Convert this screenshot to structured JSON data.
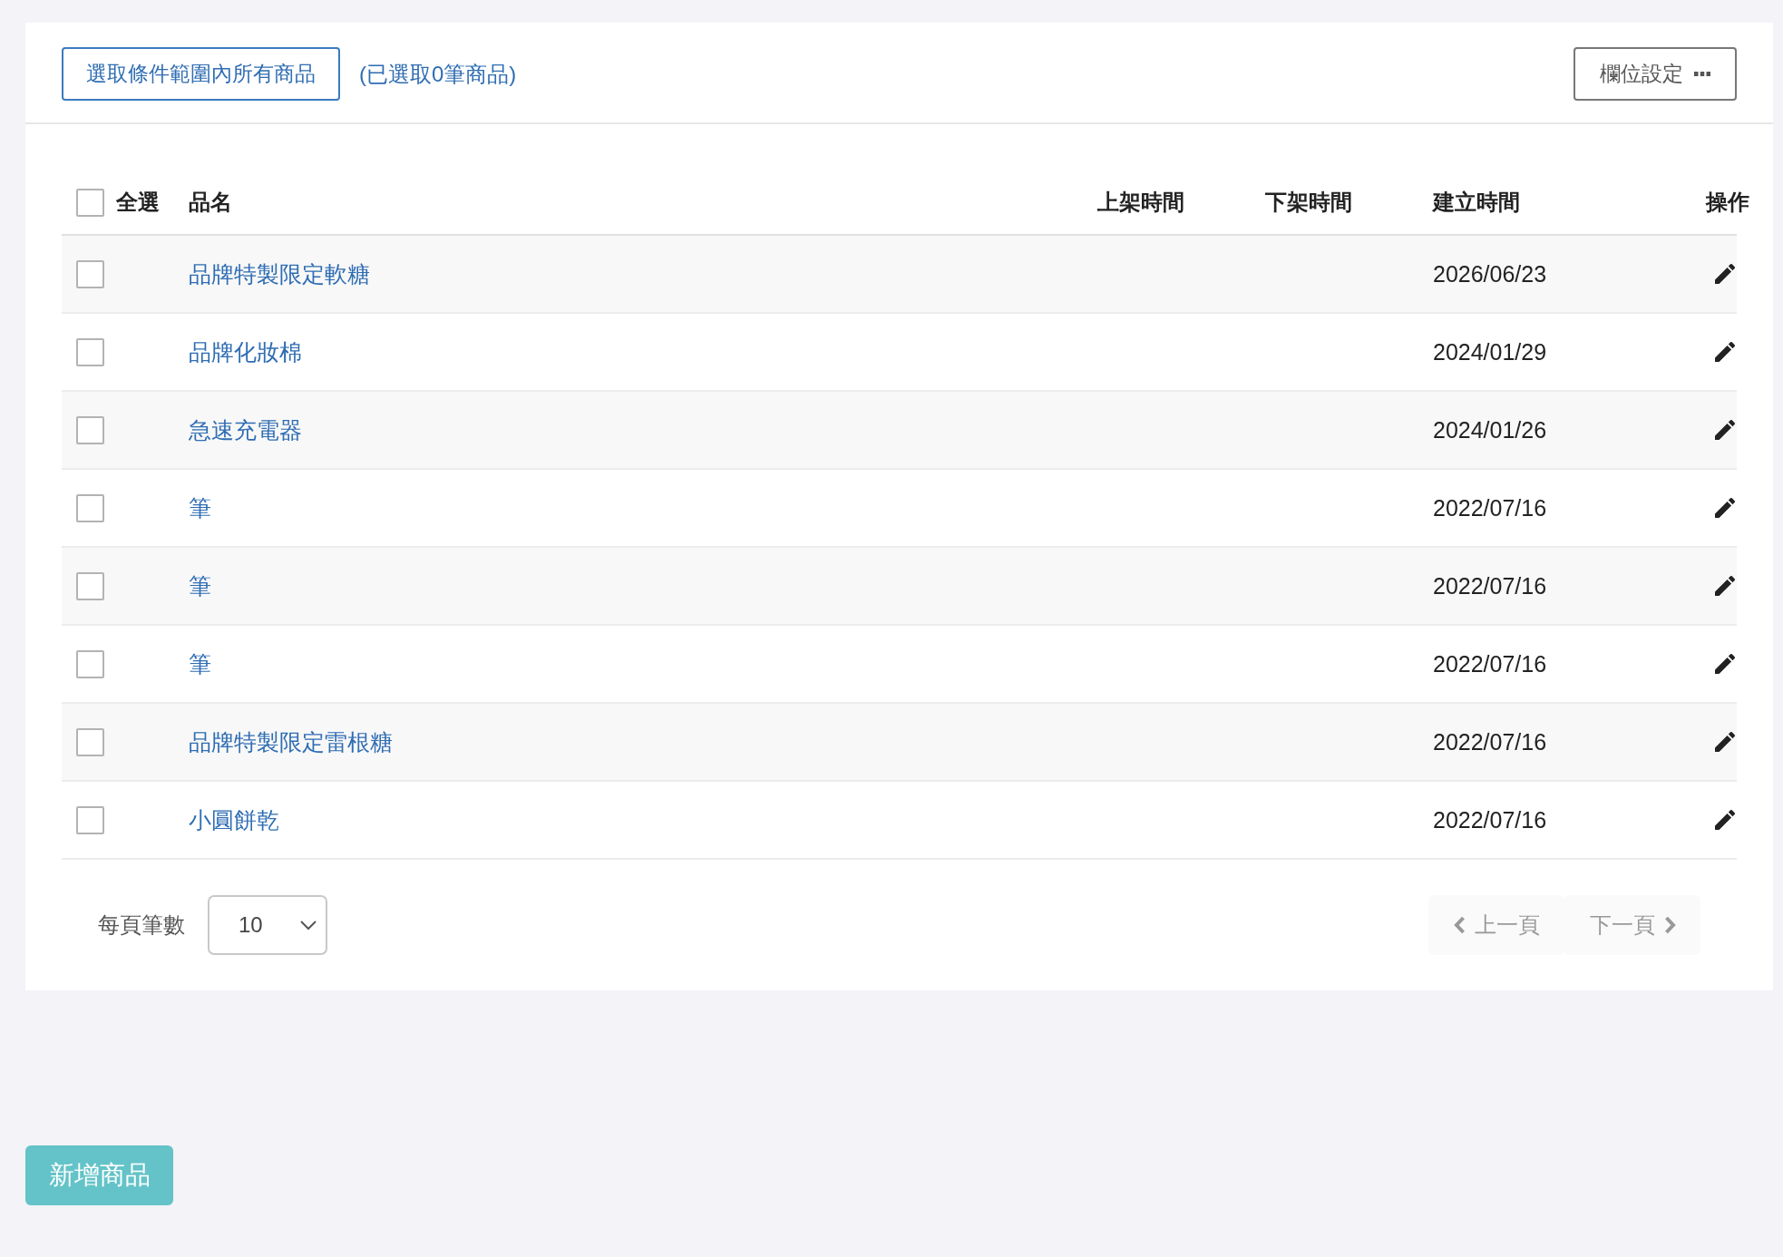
{
  "toolbar": {
    "select_all_button": "選取條件範圍內所有商品",
    "selected_count": "(已選取0筆商品)",
    "column_settings_button": "欄位設定"
  },
  "table": {
    "select_all": {
      "label": "全選",
      "checked": false
    },
    "columns": [
      "品名",
      "上架時間",
      "下架時間",
      "建立時間",
      "操作"
    ],
    "rows": [
      {
        "checked": false,
        "name": "品牌特製限定軟糖",
        "created": "2026/06/23"
      },
      {
        "checked": false,
        "name": "品牌化妝棉",
        "created": "2024/01/29"
      },
      {
        "checked": false,
        "name": "急速充電器",
        "created": "2024/01/26"
      },
      {
        "checked": false,
        "name": "筆",
        "created": "2022/07/16"
      },
      {
        "checked": false,
        "name": "筆",
        "created": "2022/07/16"
      },
      {
        "checked": false,
        "name": "筆",
        "created": "2022/07/16"
      },
      {
        "checked": false,
        "name": "品牌特製限定雷根糖",
        "created": "2022/07/16"
      },
      {
        "checked": false,
        "name": "小圓餅乾",
        "created": "2022/07/16"
      }
    ]
  },
  "pagination": {
    "label": "每頁筆數",
    "page_size": "10",
    "prev": {
      "label": "上一頁",
      "disabled": true
    },
    "next": {
      "label": "下一頁",
      "disabled": true
    }
  },
  "add_button": "新增商品"
}
